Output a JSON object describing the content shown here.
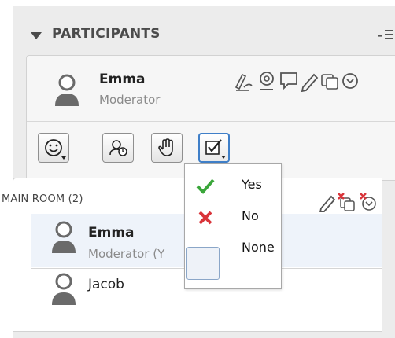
{
  "panel": {
    "title": "PARTICIPANTS"
  },
  "me": {
    "name": "Emma",
    "role": "Moderator"
  },
  "status_buttons": [
    {
      "icon": "smiley-icon"
    },
    {
      "icon": "away-icon"
    },
    {
      "icon": "raise-hand-icon"
    },
    {
      "icon": "poll-checkbox-icon",
      "active": true
    }
  ],
  "room": {
    "label": "MAIN ROOM (2)",
    "participants": [
      {
        "name": "Emma",
        "role": "Moderator (Y",
        "bold": true
      },
      {
        "name": "Jacob",
        "role": "",
        "bold": false
      }
    ]
  },
  "poll_menu": {
    "options": [
      {
        "label": "Yes",
        "icon": "check-icon",
        "color": "#3aa63a"
      },
      {
        "label": "No",
        "icon": "x-icon",
        "color": "#d9343a"
      },
      {
        "label": "None",
        "icon": "empty-box-icon"
      }
    ]
  },
  "colors": {
    "accent": "#3f7fc8",
    "panel_bg": "#ececec",
    "role_text": "#8a8a8a",
    "alert_red": "#d9343a"
  }
}
